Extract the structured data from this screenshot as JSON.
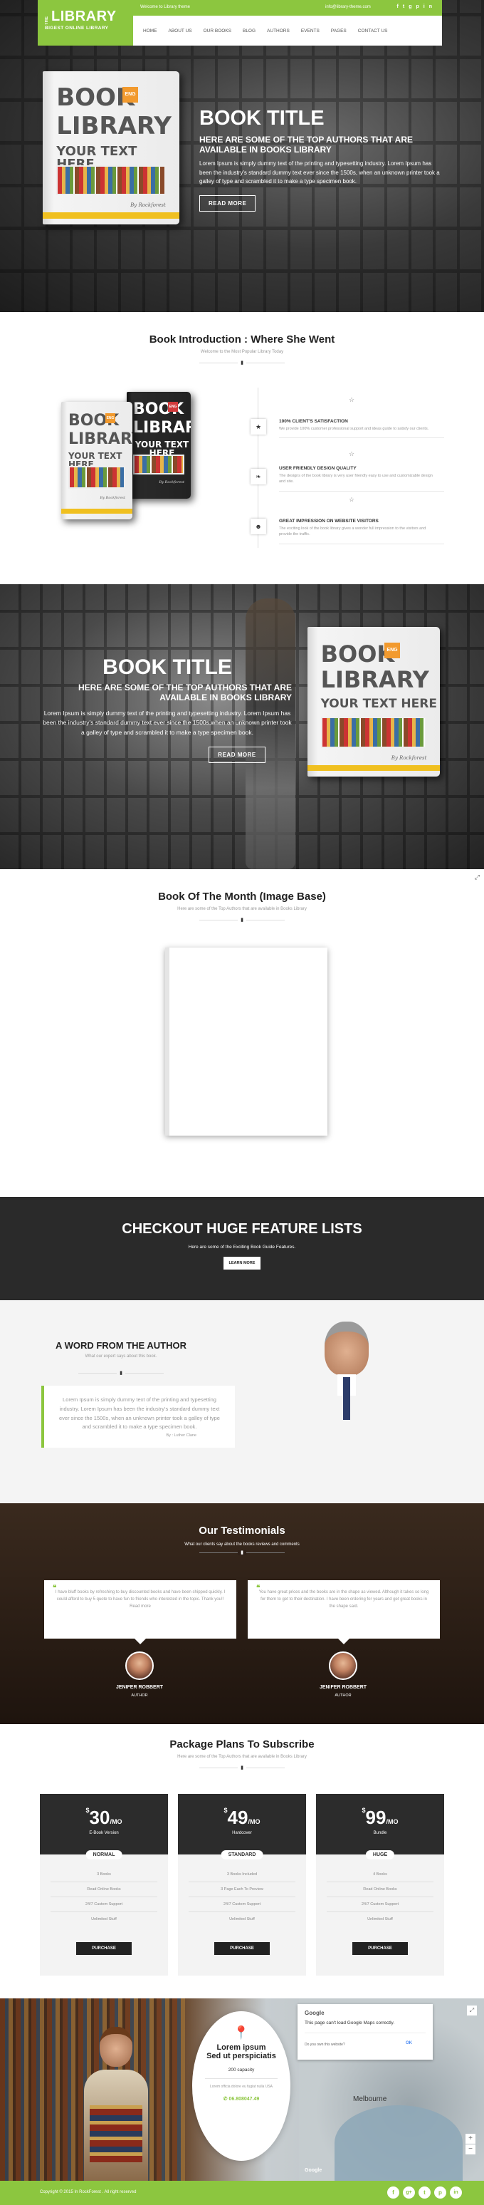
{
  "header": {
    "logo_top": "THE",
    "logo_main": "LIBRARY",
    "logo_sub": "BIGEST ONLINE LIBRARY",
    "welcome": "Welcome to Library theme",
    "email": "info@library-theme.com",
    "nav": [
      "HOME",
      "ABOUT US",
      "OUR BOOKS",
      "BLOG",
      "AUTHORS",
      "EVENTS",
      "PAGES",
      "CONTACT US"
    ]
  },
  "hero": {
    "title": "BOOK TITLE",
    "subtitle": "HERE ARE SOME OF THE TOP AUTHORS THAT ARE AVAILABLE IN BOOKS LIBRARY",
    "body": "Lorem Ipsum is simply dummy text of the printing and typesetting industry. Lorem Ipsum has been the industry's standard dummy text ever since the 1500s, when an unknown printer took a galley of type and scrambled it to make a type specimen book.",
    "button": "READ MORE"
  },
  "book_cover": {
    "line1": "BOOK",
    "badge": "ENG",
    "line2": "LIBRARY",
    "line3": "YOUR TEXT HERE",
    "signature": "By Rockforest"
  },
  "intro": {
    "title": "Book Introduction : Where She Went",
    "subtitle": "Welcome to the Most Popular Library Today",
    "features": [
      {
        "title": "100% CLIENT'S SATISFACTION",
        "text": "We provide 100% customer professional support and ideas guide to satisfy our clients."
      },
      {
        "title": "USER FRIENDLY DESIGN QUALITY",
        "text": "The designs of the book library is very user friendly easy to use and customizable design and site."
      },
      {
        "title": "GREAT IMPRESSION ON WEBSITE VISITORS",
        "text": "The exciting look of the book library gives a wonder full impression to the visitors and provide the traffic."
      }
    ]
  },
  "hero2": {
    "title": "BOOK TITLE",
    "subtitle": "HERE ARE SOME OF THE TOP AUTHORS THAT ARE AVAILABLE IN BOOKS LIBRARY",
    "body": "Lorem Ipsum is simply dummy text of the printing and typesetting industry. Lorem Ipsum has been the industry's standard dummy text ever since the 1500s,when an unknown printer took a galley of type and scrambled it to make a type specimen book.",
    "button": "READ MORE"
  },
  "month": {
    "title": "Book Of The Month (Image Base)",
    "subtitle": "Here are some of the Top Authors that are available in Books Library"
  },
  "features_banner": {
    "title": "CHECKOUT HUGE FEATURE LISTS",
    "subtitle": "Here are some of the Exciting Book Guide Features.",
    "button": "LEARN MORE"
  },
  "author": {
    "title": "A WORD FROM THE AUTHOR",
    "subtitle": "What our expert says about this book.",
    "quote": "Lorem Ipsum is simply dummy text of the printing and typesetting industry. Lorem Ipsum has been the industry's standard dummy text ever since the 1500s, when an unknown printer took a galley of type and scrambled it to make a type specimen book.",
    "signature": "By : Luther Clane"
  },
  "testimonials": {
    "title": "Our Testimonials",
    "subtitle": "What our clients say about the books reviews and comments",
    "items": [
      {
        "text": "I have bluff books by refreshing to buy discounted books and have been shipped quickly. I could afford to buy 5 quote to have fun to friends who interested in the topic. Thank you!! Read more",
        "name": "JENIFER ROBBERT",
        "role": "AUTHOR"
      },
      {
        "text": "You have great prices and the books are in the shape as viewed. Although it takes so long for them to get to their destination. I have been ordering for years and get great books in the shape said.",
        "name": "JENIFER ROBBERT",
        "role": "AUTHOR"
      }
    ]
  },
  "plans": {
    "title": "Package Plans To Subscribe",
    "subtitle": "Here are some of the Top Authors that are available in Books Library",
    "items": [
      {
        "currency": "$",
        "price": "30",
        "per": "/MO",
        "label": "E-Book Version",
        "tag": "NORMAL",
        "features": [
          "3 Books",
          "Read Online Books",
          "24/7 Custom Support",
          "Unlimited Stuff"
        ],
        "button": "PURCHASE"
      },
      {
        "currency": "$",
        "price": "49",
        "per": "/MO",
        "label": "Hardcover",
        "tag": "STANDARD",
        "features": [
          "3 Books Included",
          "3 Page Each To Preview",
          "24/7 Custom Support",
          "Unlimited Stuff"
        ],
        "button": "PURCHASE"
      },
      {
        "currency": "$",
        "price": "99",
        "per": "/MO",
        "label": "Bundle",
        "tag": "HUGE",
        "features": [
          "4 Books",
          "Read Online Books",
          "24/7 Custom Support",
          "Unlimited Stuff"
        ],
        "button": "PURCHASE"
      }
    ]
  },
  "contact": {
    "title1": "Lorem ipsum",
    "title2": "Sed ut perspiciatis",
    "capacity": "200 capacity",
    "desc": "Lorem officia dolore eu fugiat nulla USA",
    "phone": "06.808047.49",
    "google_logo": "Google",
    "map_error": "This page can't load Google Maps correctly.",
    "map_question": "Do you own this website?",
    "map_ok": "OK",
    "city": "Melbourne"
  },
  "footer": {
    "copyright": "Copyright © 2015 In RockForest . All right reserved"
  }
}
